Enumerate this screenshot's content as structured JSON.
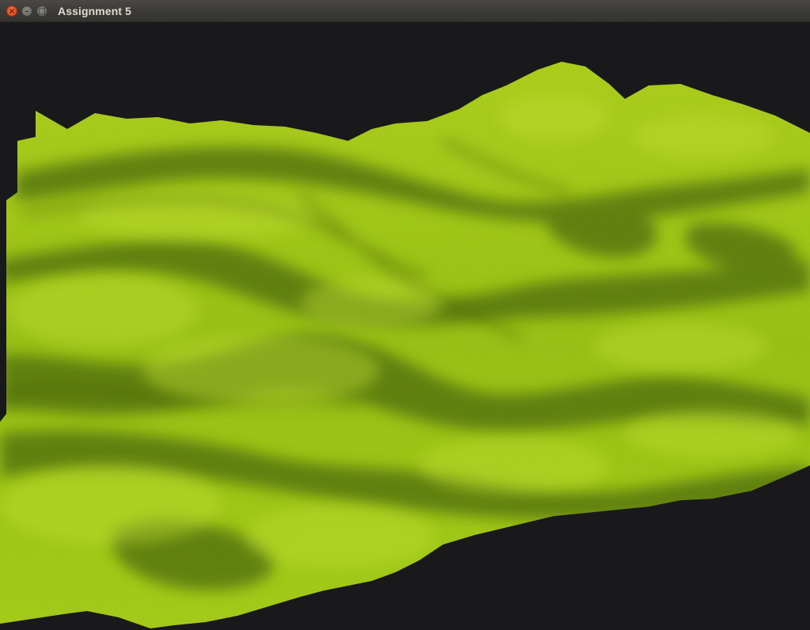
{
  "window": {
    "title": "Assignment 5",
    "buttons": {
      "close_icon": "close-icon",
      "minimize_icon": "minimize-icon",
      "maximize_icon": "maximize-icon"
    }
  },
  "scene": {
    "background_color": "#19191b",
    "terrain_base_color": "#8fb11a",
    "terrain_light_color": "#b4d12a",
    "terrain_shadow_color": "#4f6a0a",
    "description_icon": "terrain-render"
  }
}
